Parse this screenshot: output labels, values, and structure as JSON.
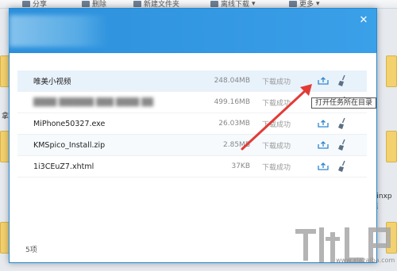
{
  "background": {
    "toolbar": {
      "share_label": "分享",
      "delete_label": "删除",
      "new_folder_label": "新建文件夹",
      "offline_download_label": "离线下载",
      "more_label": "更多"
    },
    "side_texts": {
      "left_fragment": "拿",
      "right_fragment": "winxp纯"
    }
  },
  "dialog": {
    "close_symbol": "✕",
    "files": [
      {
        "name": "唯美小视频",
        "size": "248.04MB",
        "status": "下载成功"
      },
      {
        "name": "████ ██████ ███ ████ ██",
        "size": "499.16MB",
        "status": "下载成功"
      },
      {
        "name": "MiPhone50327.exe",
        "size": "26.03MB",
        "status": "下载成功"
      },
      {
        "name": "KMSpico_Install.zip",
        "size": "2.85MB",
        "status": "下载成功"
      },
      {
        "name": "1i3CEuZ7.xhtml",
        "size": "37KB",
        "status": "下载成功"
      }
    ],
    "tooltip": "打开任务所在目录",
    "footer_count": "5项"
  },
  "watermark": {
    "url_text": "www.xiazaiba.com"
  },
  "icons": {
    "open_folder": "folder-open-icon",
    "clean": "broom-icon",
    "arrow_color": "#e23b36",
    "accent": "#2c8fdb"
  }
}
